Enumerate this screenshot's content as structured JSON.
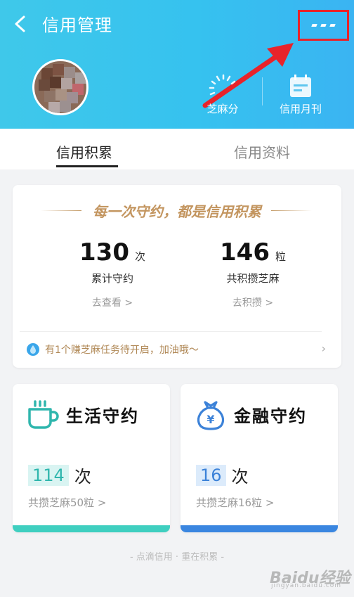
{
  "header": {
    "title": "信用管理",
    "sesame_label": "芝麻分",
    "monthly_label": "信用月刊"
  },
  "tabs": [
    {
      "label": "信用积累",
      "active": true
    },
    {
      "label": "信用资料",
      "active": false
    }
  ],
  "main_card": {
    "slogan": "每一次守约，都是信用积累",
    "stats": [
      {
        "value": "130",
        "unit": "次",
        "label": "累计守约",
        "link": "去查看 >"
      },
      {
        "value": "146",
        "unit": "粒",
        "label": "共积攒芝麻",
        "link": "去积攒 >"
      }
    ],
    "tip": "有1个赚芝麻任务待开启，加油哦～"
  },
  "cards": [
    {
      "title": "生活守约",
      "count": "114",
      "unit": "次",
      "link": "共攒芝麻50粒 >",
      "icon": "cup-icon"
    },
    {
      "title": "金融守约",
      "count": "16",
      "unit": "次",
      "link": "共攒芝麻16粒 >",
      "icon": "money-bag-icon"
    }
  ],
  "footer": "- 点滴信用 · 重在积累 -",
  "watermark": {
    "text": "Baidu经验",
    "sub": "jingyan.baidu.com"
  },
  "colors": {
    "header_start": "#3fc8ea",
    "header_end": "#3ab4f2",
    "gold": "#c3955f",
    "life_accent": "#3fcfc0",
    "finance_accent": "#3a86e0",
    "highlight_red": "#e8232a"
  }
}
